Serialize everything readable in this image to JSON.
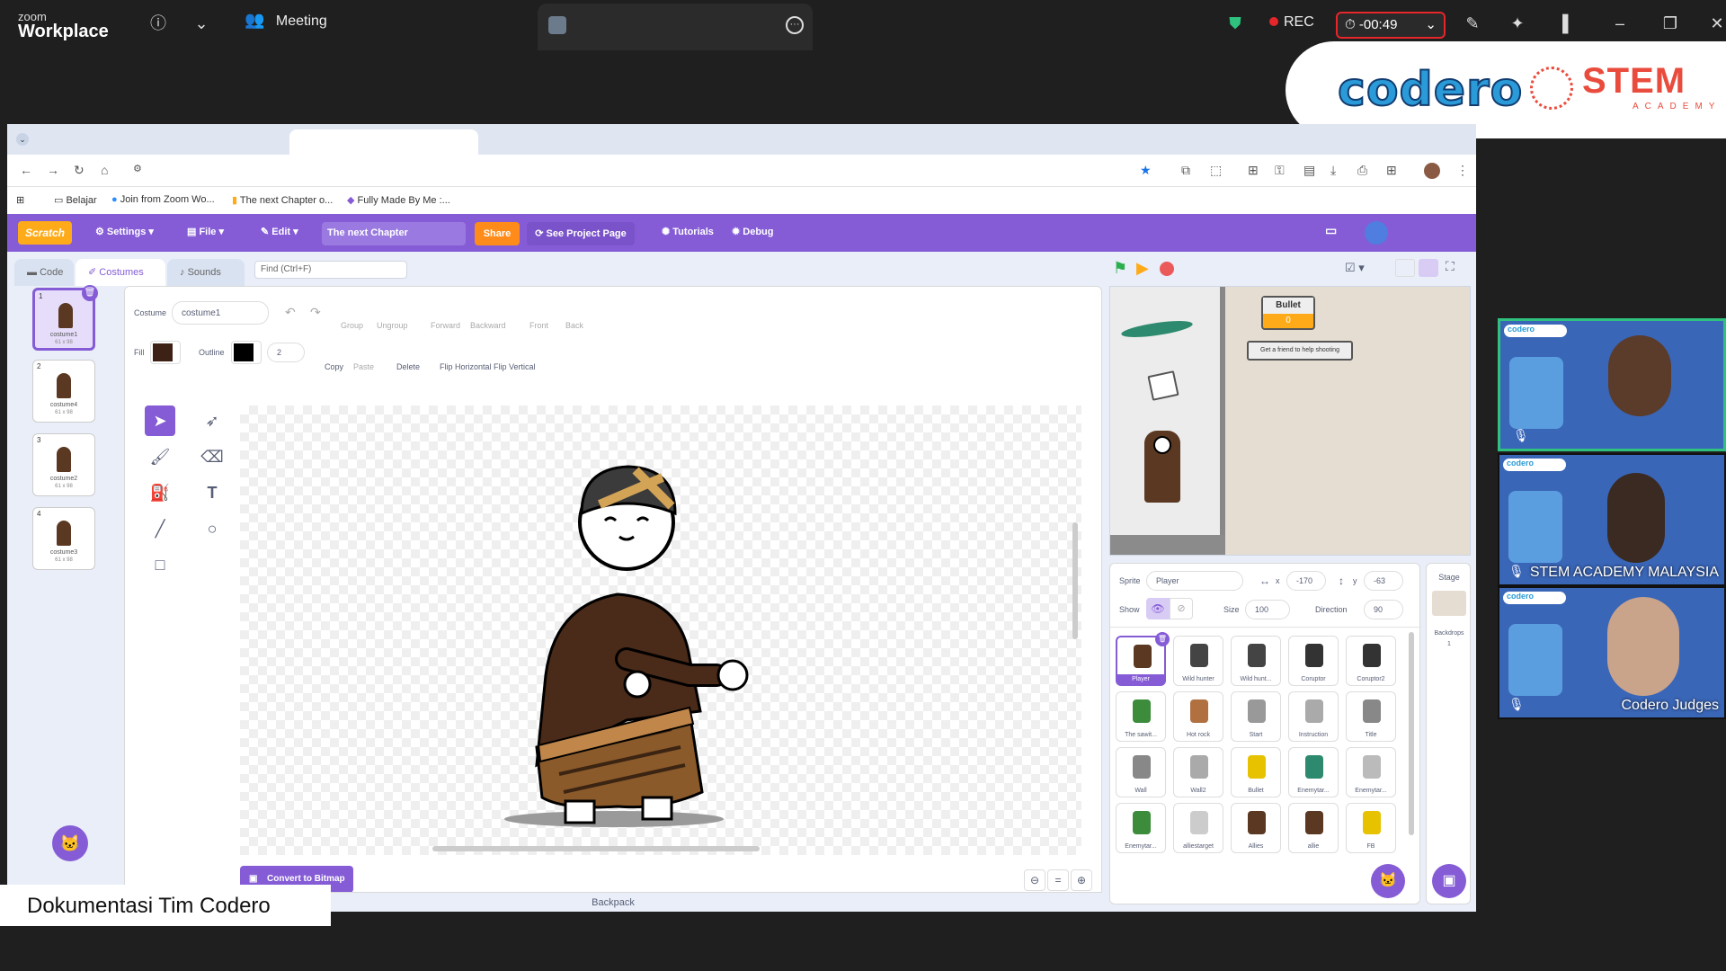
{
  "zoom": {
    "brand_top": "zoom",
    "brand_bottom": "Workplace",
    "meeting_label": "Meeting",
    "rec_label": "REC",
    "timer": "-00:49"
  },
  "logos": {
    "codero": "codero",
    "stem": "STEM",
    "academy": "ACADEMY"
  },
  "bookmarks": [
    {
      "label": "Belajar"
    },
    {
      "label": "Join from Zoom Wo..."
    },
    {
      "label": "The next Chapter o..."
    },
    {
      "label": "Fully Made By Me :..."
    }
  ],
  "scratch": {
    "menu": {
      "settings": "Settings",
      "file": "File",
      "edit": "Edit",
      "project_title": "The next Chapter",
      "share": "Share",
      "see_project": "See Project Page",
      "tutorials": "Tutorials",
      "debug": "Debug"
    },
    "tabs": {
      "code": "Code",
      "costumes": "Costumes",
      "sounds": "Sounds"
    },
    "find_placeholder": "Find (Ctrl+F)",
    "costumes": [
      {
        "num": "1",
        "name": "costume1",
        "size": "61 x 98"
      },
      {
        "num": "2",
        "name": "costume4",
        "size": "61 x 98"
      },
      {
        "num": "3",
        "name": "costume2",
        "size": "61 x 98"
      },
      {
        "num": "4",
        "name": "costume3",
        "size": "61 x 98"
      }
    ],
    "paint": {
      "costume_label": "Costume",
      "costume_name": "costume1",
      "group": "Group",
      "ungroup": "Ungroup",
      "forward": "Forward",
      "backward": "Backward",
      "front": "Front",
      "back": "Back",
      "fill_label": "Fill",
      "outline_label": "Outline",
      "outline_width": "2",
      "copy": "Copy",
      "paste": "Paste",
      "delete": "Delete",
      "flip_h": "Flip Horizontal",
      "flip_v": "Flip Vertical",
      "convert": "Convert to Bitmap",
      "backpack": "Backpack",
      "fill_color": "#3e2115",
      "outline_color": "#000000"
    },
    "stage": {
      "bullet_label": "Bullet",
      "bullet_value": "0",
      "hint": "Get a friend to help shooting"
    },
    "sprite_info": {
      "sprite_label": "Sprite",
      "sprite_name": "Player",
      "x_label": "x",
      "x": "-170",
      "y_label": "y",
      "y": "-63",
      "show_label": "Show",
      "size_label": "Size",
      "size": "100",
      "direction_label": "Direction",
      "direction": "90"
    },
    "stage_panel": {
      "title": "Stage",
      "backdrops_label": "Backdrops",
      "backdrops_count": "1"
    },
    "sprites": [
      {
        "name": "Player",
        "color": "#5a3822"
      },
      {
        "name": "Wild hunter",
        "color": "#444"
      },
      {
        "name": "Wild hunt...",
        "color": "#444"
      },
      {
        "name": "Coruptor",
        "color": "#333"
      },
      {
        "name": "Coruptor2",
        "color": "#333"
      },
      {
        "name": "The sawit...",
        "color": "#3c8c3c"
      },
      {
        "name": "Hot rock",
        "color": "#b07040"
      },
      {
        "name": "Start",
        "color": "#999"
      },
      {
        "name": "Instruction",
        "color": "#aaa"
      },
      {
        "name": "Title",
        "color": "#888"
      },
      {
        "name": "Wall",
        "color": "#888"
      },
      {
        "name": "Wall2",
        "color": "#aaa"
      },
      {
        "name": "Bullet",
        "color": "#e6c200"
      },
      {
        "name": "Enemytar...",
        "color": "#2d8a6e"
      },
      {
        "name": "Enemytar...",
        "color": "#bbb"
      },
      {
        "name": "Enemytar...",
        "color": "#3c8c3c"
      },
      {
        "name": "alliestarget",
        "color": "#ccc"
      },
      {
        "name": "Allies",
        "color": "#5a3822"
      },
      {
        "name": "allie",
        "color": "#5a3822"
      },
      {
        "name": "FB",
        "color": "#e6c200"
      }
    ]
  },
  "participants": [
    {
      "name": ""
    },
    {
      "name": "STEM ACADEMY MALAYSIA"
    },
    {
      "name": "Codero Judges"
    }
  ],
  "caption": "Dokumentasi Tim Codero"
}
